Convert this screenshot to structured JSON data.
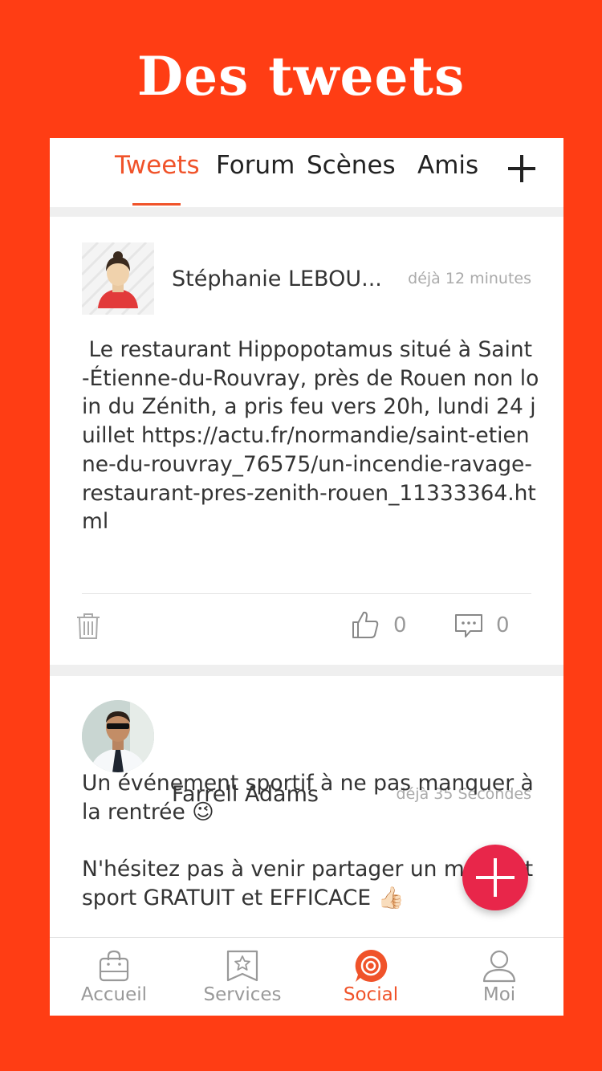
{
  "hero": {
    "title": "Des tweets"
  },
  "tabs": [
    {
      "label": "Tweets",
      "active": true
    },
    {
      "label": "Forum"
    },
    {
      "label": "Scènes"
    },
    {
      "label": "Amis"
    }
  ],
  "posts": [
    {
      "author": "Stéphanie LEBOU...",
      "time": "déjà 12 minutes",
      "text": " Le restaurant Hippopotamus situé à Saint-Étienne-du-Rouvray, près de Rouen non loin du Zénith, a pris feu vers 20h, lundi 24 juillet https://actu.fr/normandie/saint-etienne-du-rouvray_76575/un-incendie-ravage-restaurant-pres-zenith-rouen_11333364.html",
      "likes": "0",
      "comments": "0"
    },
    {
      "author": "Farrell Adams",
      "time": "déjà 35 Secondes",
      "text": "Un événement sportif à ne pas manquer à la rentrée 😉\n\nN'hésitez pas à venir partager un moment sport GRATUIT et EFFICACE 👍🏻"
    }
  ],
  "tabbar": [
    {
      "label": "Accueil",
      "icon": "bag-icon"
    },
    {
      "label": "Services",
      "icon": "star-bookmark-icon"
    },
    {
      "label": "Social",
      "icon": "social-target-icon",
      "active": true
    },
    {
      "label": "Moi",
      "icon": "person-icon"
    }
  ],
  "colors": {
    "background": "#ff3d14",
    "accent": "#f0532a",
    "fab": "#e8264a"
  }
}
